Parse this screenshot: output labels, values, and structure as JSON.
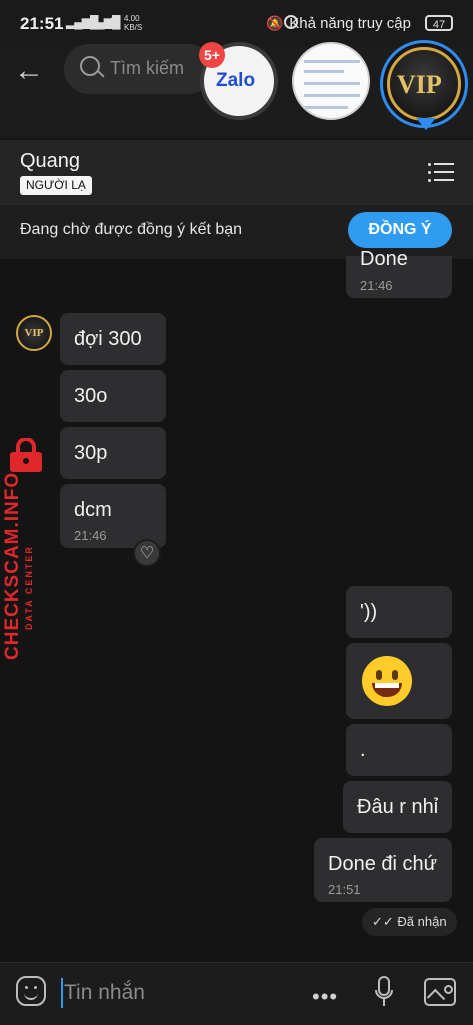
{
  "status_bar": {
    "time": "21:51",
    "net_speed": "4.00 KB/S",
    "accessibility": "Khả năng truy cập",
    "battery": "47"
  },
  "search": {
    "placeholder": "Tìm kiếm"
  },
  "chat_heads": {
    "zalo_label": "Zalo",
    "badge": "5+",
    "vip_label": "VIP"
  },
  "header": {
    "name": "Quang",
    "tag": "NGƯỜI LẠ"
  },
  "friend_request": {
    "text": "Đang chờ được đồng ý kết bạn",
    "button": "ĐỒNG Ý"
  },
  "messages": {
    "sent_top": {
      "text": "Done",
      "time": "21:46"
    },
    "received": [
      {
        "text": "đợi 300"
      },
      {
        "text": "30o"
      },
      {
        "text": "30p"
      },
      {
        "text": "dcm",
        "time": "21:46"
      }
    ],
    "sent": [
      {
        "text": "'))"
      },
      {
        "text": "😀",
        "emoji": true
      },
      {
        "text": "."
      },
      {
        "text": "Đâu r nhỉ"
      },
      {
        "text": "Done đi chứ",
        "time": "21:51"
      }
    ],
    "status": "Đã nhận"
  },
  "watermark": {
    "main": "CHECKSCAM.INFO",
    "sub": "DATA CENTER"
  },
  "input": {
    "placeholder": "Tin nhắn",
    "more": "•••"
  },
  "colors": {
    "accent": "#2f9cf0",
    "bubble": "#2e2e30",
    "background": "#141414",
    "watermark": "#e0282b"
  }
}
